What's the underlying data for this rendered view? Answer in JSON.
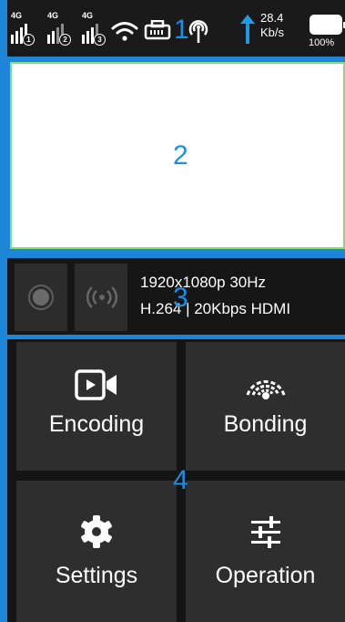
{
  "status_bar": {
    "signals": [
      {
        "network": "4G",
        "slot": "1"
      },
      {
        "network": "4G",
        "slot": "2"
      },
      {
        "network": "4G",
        "slot": "3"
      }
    ],
    "upload_speed_value": "28.4",
    "upload_speed_unit": "Kb/s",
    "battery_level": "100%"
  },
  "info_bar": {
    "video_format": "1920x1080p 30Hz",
    "encoding_info": "H.264 | 20Kbps HDMI"
  },
  "menu": [
    {
      "label": "Encoding",
      "icon": "video-camera-icon"
    },
    {
      "label": "Bonding",
      "icon": "bonding-icon"
    },
    {
      "label": "Settings",
      "icon": "gear-icon"
    },
    {
      "label": "Operation",
      "icon": "sliders-icon"
    }
  ],
  "annotations": [
    "1",
    "2",
    "3",
    "4"
  ],
  "colors": {
    "background": "#1d86d8",
    "annotation": "#1a8fe6",
    "preview_border": "#7de07a",
    "tile": "#2e2e2e"
  }
}
